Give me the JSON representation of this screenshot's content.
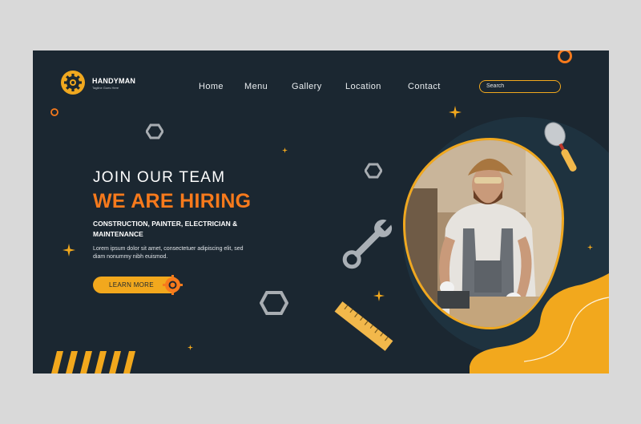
{
  "logo": {
    "name": "HANDYMAN",
    "tagline": "Tagline Goes Here",
    "icon": "gear-icon"
  },
  "nav": {
    "items": [
      {
        "label": "Home"
      },
      {
        "label": "Menu"
      },
      {
        "label": "Gallery"
      },
      {
        "label": "Location"
      },
      {
        "label": "Contact"
      }
    ],
    "search": {
      "placeholder": "Search",
      "value": ""
    }
  },
  "hero": {
    "eyebrow": "JOIN OUR TEAM",
    "title": "WE ARE HIRING",
    "services": "CONSTRUCTION, PAINTER, ELECTRICIAN & MAINTENANCE",
    "body": "Lorem ipsum dolor sit amet, consectetuer adipiscing elit, sed diam nonummy nibh euismod.",
    "cta_label": "LEARN MORE"
  },
  "colors": {
    "background": "#1b2731",
    "accent_orange": "#f77a1c",
    "accent_yellow": "#f2a81d",
    "text_light": "#ffffff"
  },
  "decorations": {
    "icons": [
      "hex-nut-icon",
      "wrench-icon",
      "ruler-icon",
      "putty-knife-icon",
      "sparkle-icon",
      "circle-outline-icon"
    ]
  }
}
